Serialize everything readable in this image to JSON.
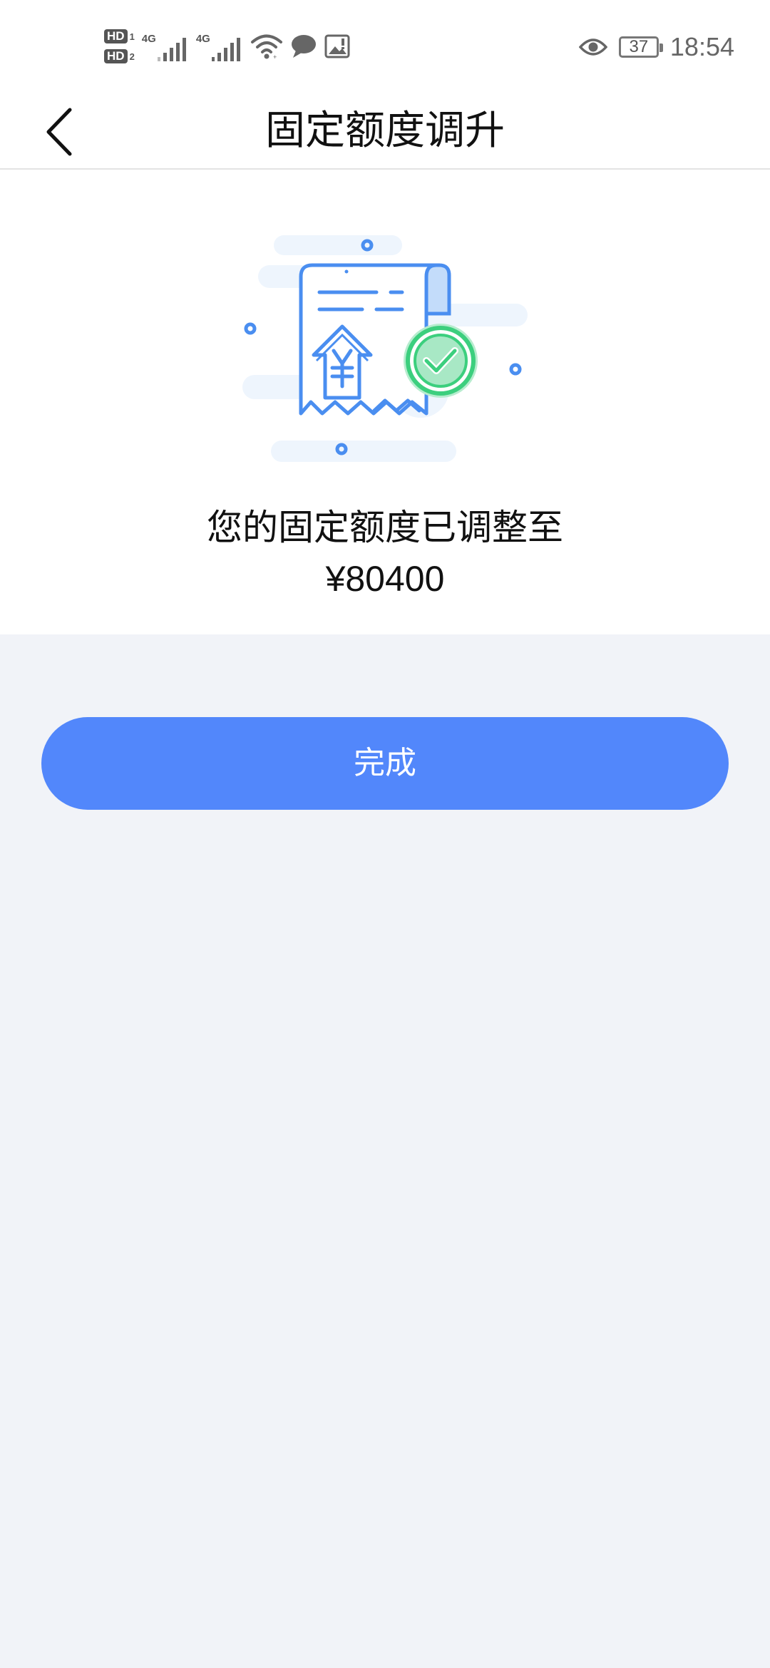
{
  "status_bar": {
    "sim1_badge": "HD",
    "sim1_num": "1",
    "sim2_badge": "HD",
    "sim2_num": "2",
    "network1": "4G",
    "network2": "4G",
    "battery_level": "37",
    "time": "18:54",
    "icons": [
      "signal-icon",
      "signal-icon",
      "wifi-icon",
      "message-icon",
      "image-alert-icon",
      "eye-icon",
      "battery-icon"
    ]
  },
  "nav": {
    "title": "固定额度调升",
    "back_icon": "chevron-left-icon"
  },
  "result": {
    "illustration": "receipt-approved-illustration",
    "message": "您的固定额度已调整至",
    "amount": "¥80400"
  },
  "actions": {
    "done_label": "完成"
  },
  "colors": {
    "accent": "#5287fb",
    "illustration_blue": "#4a8ef0",
    "success_green": "#3ccf7e",
    "page_bg": "#f1f3f8"
  }
}
